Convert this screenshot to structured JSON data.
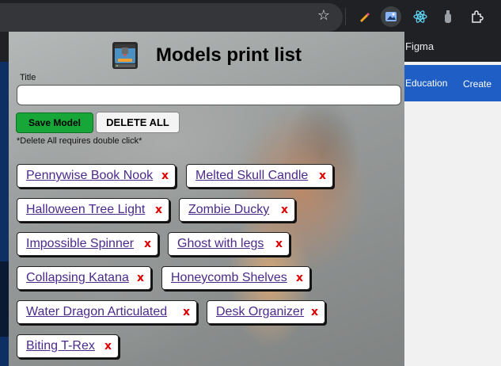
{
  "browser": {
    "bookmark_partial": "Figma",
    "extensions": [
      "pen-icon",
      "picture-icon",
      "react-icon",
      "extension-puzzle-icon"
    ]
  },
  "background_page": {
    "nav_education": "Education",
    "nav_create": "Create"
  },
  "popup": {
    "title": "Models print list",
    "title_label": "Title",
    "title_value": "",
    "save_button": "Save Model",
    "delete_all_button": "DELETE ALL",
    "delete_note": "*Delete All requires double click*",
    "remove_glyph": "x",
    "models": [
      "Pennywise Book Nook",
      "Melted Skull Candle",
      "Halloween Tree Light",
      "Zombie Ducky",
      "Impossible Spinner",
      "Ghost with legs",
      "Collapsing Katana",
      "Honeycomb Shelves",
      "Water Dragon Articulated",
      "Desk Organizer",
      "Biting T-Rex"
    ],
    "colors": {
      "save_green": "#17a638",
      "link_purple": "#4b2a8c",
      "remove_red": "#e00000"
    }
  }
}
